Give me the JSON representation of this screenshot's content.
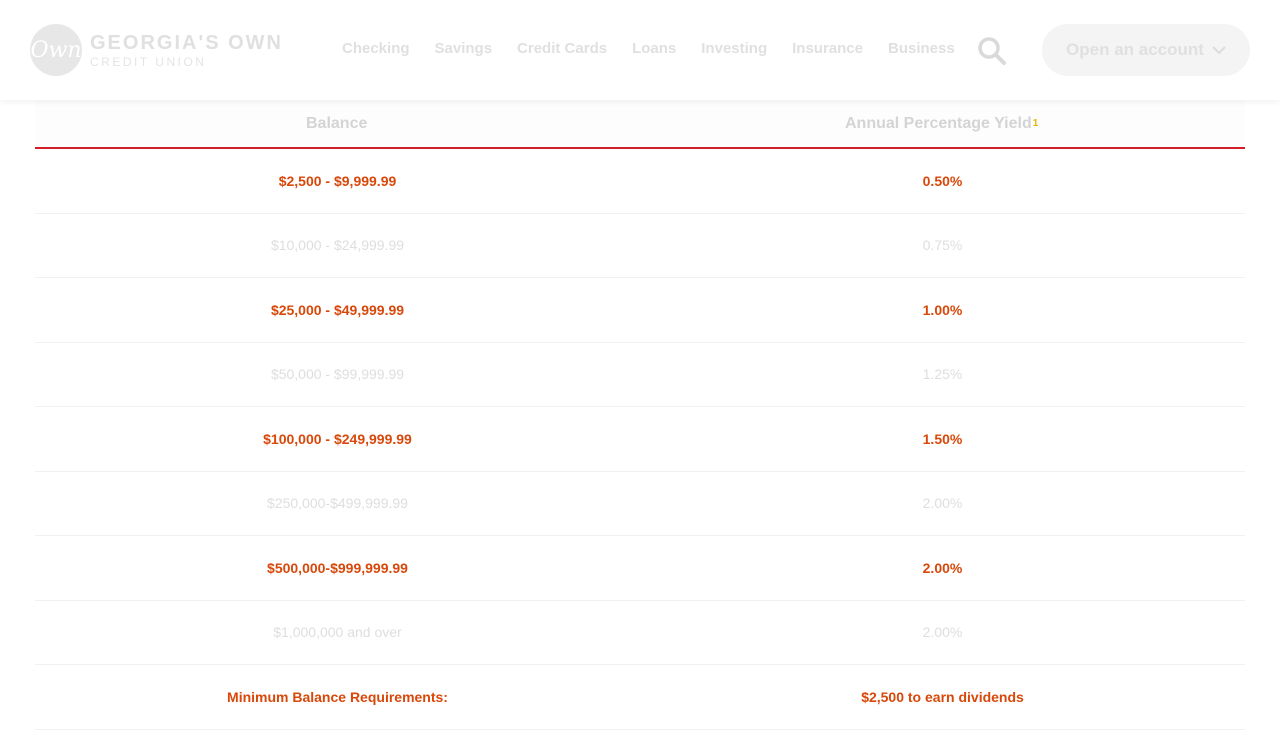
{
  "logo": {
    "mark": "Own",
    "line1": "GEORGIA'S OWN",
    "line2": "CREDIT UNION"
  },
  "nav": [
    "Checking",
    "Savings",
    "Credit Cards",
    "Loans",
    "Investing",
    "Insurance",
    "Business"
  ],
  "cta": {
    "label": "Open an account"
  },
  "table": {
    "headers": {
      "balance": "Balance",
      "apy": "Annual Percentage Yield",
      "apy_note": "1"
    },
    "rows": [
      {
        "balance": "$2,500 - $9,999.99",
        "apy": "0.50%"
      },
      {
        "balance": "$10,000 - $24,999.99",
        "apy": "0.75%"
      },
      {
        "balance": "$25,000 - $49,999.99",
        "apy": "1.00%"
      },
      {
        "balance": "$50,000 - $99,999.99",
        "apy": "1.25%"
      },
      {
        "balance": "$100,000 - $249,999.99",
        "apy": "1.50%"
      },
      {
        "balance": "$250,000-$499,999.99",
        "apy": "2.00%"
      },
      {
        "balance": "$500,000-$999,999.99",
        "apy": "2.00%"
      },
      {
        "balance": "$1,000,000 and over",
        "apy": "2.00%"
      }
    ],
    "footer": {
      "label": "Minimum Balance Requirements:",
      "value": "$2,500 to earn dividends"
    }
  }
}
